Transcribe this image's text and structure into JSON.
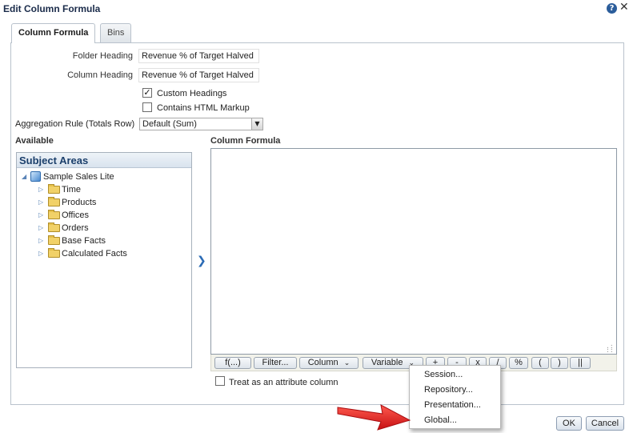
{
  "dialog": {
    "title": "Edit Column Formula"
  },
  "tabs": [
    {
      "label": "Column Formula"
    },
    {
      "label": "Bins"
    }
  ],
  "form": {
    "folder_heading_label": "Folder Heading",
    "folder_heading_value": "Revenue % of Target Halved",
    "column_heading_label": "Column Heading",
    "column_heading_value": "Revenue % of Target Halved",
    "custom_headings_label": "Custom Headings",
    "custom_headings_checked": true,
    "contains_html_label": "Contains HTML Markup",
    "contains_html_checked": false,
    "aggregation_label": "Aggregation Rule (Totals Row)",
    "aggregation_value": "Default (Sum)"
  },
  "available": {
    "heading": "Available",
    "panel_title": "Subject Areas",
    "root": "Sample Sales Lite",
    "folders": [
      "Time",
      "Products",
      "Offices",
      "Orders",
      "Base Facts",
      "Calculated Facts"
    ]
  },
  "formula": {
    "heading": "Column Formula",
    "value": "",
    "toolbar": {
      "function": "f(...)",
      "filter": "Filter...",
      "column": "Column",
      "variable": "Variable",
      "ops": [
        "+",
        "-",
        "x",
        "/",
        "%",
        "(",
        ")",
        "||"
      ]
    },
    "treat_as_attribute_label": "Treat as an attribute column",
    "treat_as_attribute_checked": false
  },
  "variable_menu": {
    "items": [
      "Session...",
      "Repository...",
      "Presentation...",
      "Global..."
    ]
  },
  "footer": {
    "ok": "OK",
    "cancel": "Cancel"
  },
  "colors": {
    "accent_arrow": "#e8191c",
    "title_text": "#1a2b4a",
    "panel_header": "#d9e3ee"
  },
  "icons": {
    "help": "help-icon",
    "close": "close-icon",
    "move": "chevron-right-icon",
    "folder": "folder-icon",
    "subject_area": "cube-icon"
  }
}
